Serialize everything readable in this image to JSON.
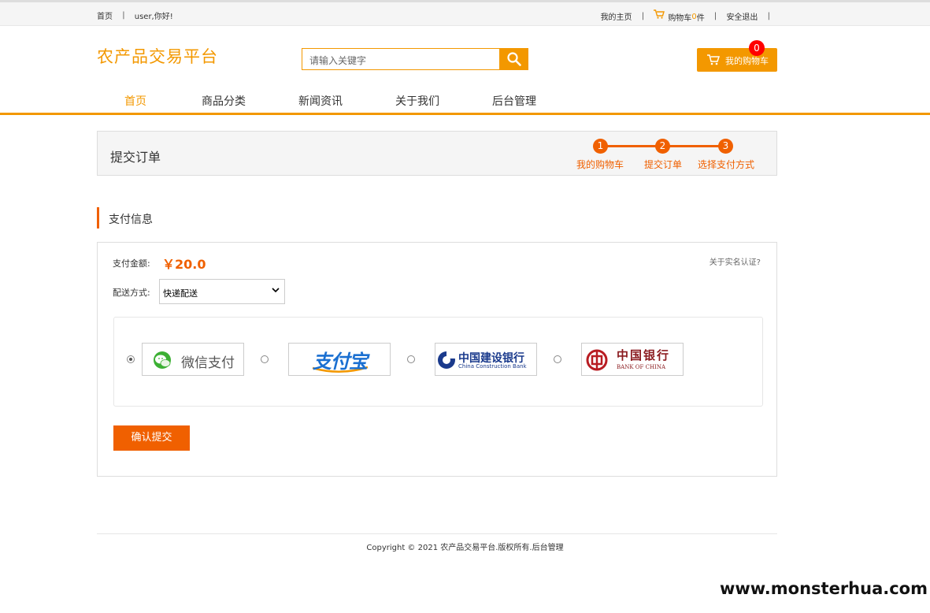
{
  "topbar": {
    "home": "首页",
    "greeting": "user,你好!",
    "my_home": "我的主页",
    "cart_prefix": "购物车",
    "cart_count": "0",
    "cart_suffix": "件",
    "logout": "安全退出",
    "sep": "|"
  },
  "header": {
    "logo": "农产品交易平台",
    "search_placeholder": "请输入关键字",
    "my_cart": "我的购物车",
    "cart_badge": "0"
  },
  "nav": {
    "items": [
      {
        "label": "首页"
      },
      {
        "label": "商品分类"
      },
      {
        "label": "新闻资讯"
      },
      {
        "label": "关于我们"
      },
      {
        "label": "后台管理"
      }
    ]
  },
  "order_head": {
    "title": "提交订单",
    "steps": [
      {
        "num": "1",
        "label": "我的购物车"
      },
      {
        "num": "2",
        "label": "提交订单"
      },
      {
        "num": "3",
        "label": "选择支付方式"
      }
    ]
  },
  "section": {
    "title": "支付信息"
  },
  "payment": {
    "amount_label": "支付金额:",
    "amount_value": "￥20.0",
    "realname_link": "关于实名认证?",
    "shipping_label": "配送方式:",
    "shipping_value": "快递配送",
    "methods": [
      {
        "name": "微信支付",
        "icon": "wechat-pay-logo"
      },
      {
        "name": "支付宝",
        "icon": "alipay-logo"
      },
      {
        "name": "中国建设银行",
        "sub": "China Construction Bank",
        "icon": "ccb-logo"
      },
      {
        "name": "中国银行",
        "sub": "BANK OF CHINA",
        "icon": "boc-logo"
      }
    ],
    "confirm": "确认提交"
  },
  "footer": {
    "copyright": "Copyright © 2021 农产品交易平台.版权所有.后台管理"
  },
  "watermark": "www.monsterhua.com",
  "colors": {
    "primary": "#f39800",
    "accent": "#f06000"
  }
}
